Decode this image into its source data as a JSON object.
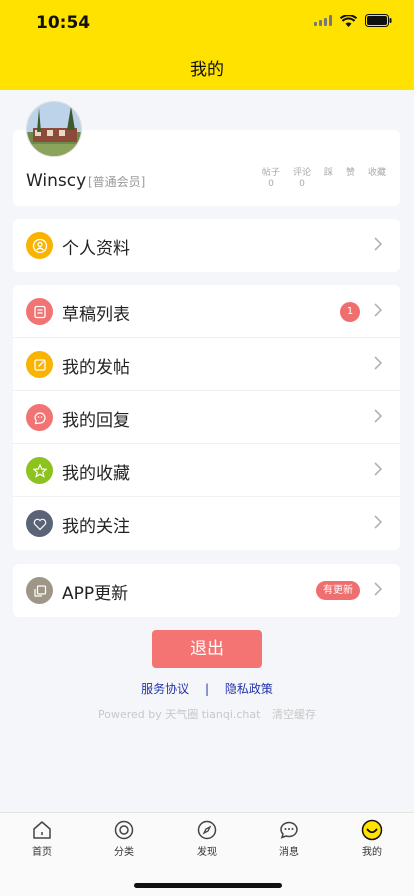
{
  "status": {
    "time": "10:54"
  },
  "nav": {
    "title": "我的"
  },
  "profile": {
    "username": "Winscy",
    "member_level": "[普通会员]",
    "stats": [
      {
        "label": "帖子",
        "value": "0"
      },
      {
        "label": "评论",
        "value": "0"
      },
      {
        "label": "踩",
        "value": ""
      },
      {
        "label": "赞",
        "value": ""
      },
      {
        "label": "收藏",
        "value": ""
      }
    ]
  },
  "menu": {
    "personal_info": "个人资料",
    "drafts": "草稿列表",
    "drafts_badge": "1",
    "my_posts": "我的发帖",
    "my_replies": "我的回复",
    "my_favorites": "我的收藏",
    "my_following": "我的关注",
    "app_update": "APP更新",
    "update_badge": "有更新"
  },
  "actions": {
    "logout": "退出",
    "terms": "服务协议",
    "separator": "|",
    "privacy": "隐私政策",
    "powered_by": "Powered by 天气圈 tianqi.chat",
    "clear_cache": "清空缓存"
  },
  "tabs": [
    {
      "label": "首页",
      "icon": "home-icon"
    },
    {
      "label": "分类",
      "icon": "category-icon"
    },
    {
      "label": "发现",
      "icon": "compass-icon"
    },
    {
      "label": "消息",
      "icon": "message-icon"
    },
    {
      "label": "我的",
      "icon": "smiley-icon"
    }
  ],
  "colors": {
    "header": "#ffe200",
    "accent_orange": "#f8b400",
    "accent_red": "#f07474",
    "accent_green": "#8dc21f",
    "accent_slate": "#5b6477",
    "accent_gray": "#9e9788"
  }
}
